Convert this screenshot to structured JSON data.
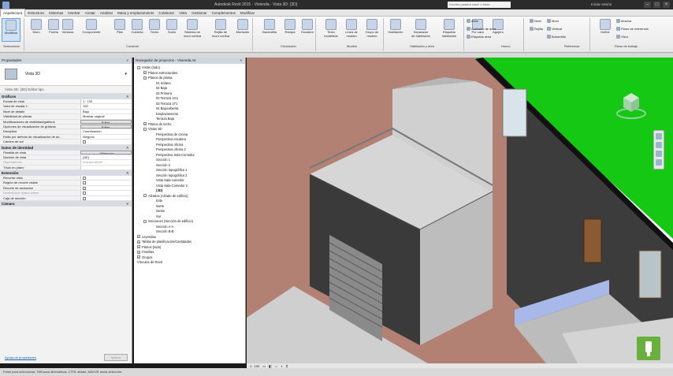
{
  "titlebar": {
    "title": "Autodesk Revit 2015 - Vivienda - Vista 3D: {3D}",
    "search_placeholder": "Escriba palabra clave o frase",
    "user": "Iniciar sesión"
  },
  "ribbon_tabs": [
    "Arquitectura",
    "Estructura",
    "Sistemas",
    "Insertar",
    "Anotar",
    "Analizar",
    "Masa y emplazamiento",
    "Colaborar",
    "Vista",
    "Gestionar",
    "Complementos",
    "Modificar"
  ],
  "ribbon": {
    "buttons": [
      {
        "label": "Modificar"
      },
      {
        "label": "Muro"
      },
      {
        "label": "Puerta"
      },
      {
        "label": "Ventana"
      },
      {
        "label": "Componente"
      },
      {
        "label": "Pilar"
      },
      {
        "label": "Cubierta"
      },
      {
        "label": "Techo"
      },
      {
        "label": "Suelo"
      },
      {
        "label": "Sistema de muro cortina"
      },
      {
        "label": "Rejilla de muro cortina"
      },
      {
        "label": "Montante"
      },
      {
        "label": "Barandilla"
      },
      {
        "label": "Rampa"
      },
      {
        "label": "Escalera"
      },
      {
        "label": "Texto modelado"
      },
      {
        "label": "Línea de modelo"
      },
      {
        "label": "Grupo de modelo"
      },
      {
        "label": "Habitación"
      },
      {
        "label": "Separador de habitación"
      },
      {
        "label": "Etiquetar habitación"
      },
      {
        "label": "Por cara"
      },
      {
        "label": "Agujero"
      },
      {
        "label": "Nivel"
      },
      {
        "label": "Rejilla"
      },
      {
        "label": "Definir"
      }
    ],
    "small": {
      "area": "Área",
      "contorno": "Contorno de área",
      "etiquetar_area": "Etiquetar área",
      "muro": "Muro",
      "vertical": "Vertical",
      "buhardilla": "Buhardilla",
      "mostrar": "Mostrar",
      "plano_ref": "Plano de referencia",
      "visor": "Visor"
    },
    "panels": [
      "Seleccionar",
      "Construir",
      "Circulación",
      "Modelo",
      "Habitación y área",
      "Hueco",
      "Referencia",
      "Plano de trabajo"
    ]
  },
  "properties": {
    "header": "Propiedades",
    "type": "Vista 3D",
    "edit_type": "Vista 3D: {3D}    Editar tipo",
    "sections": {
      "graphics": "Gráficos",
      "identity": "Datos de identidad",
      "extents": "Extensión",
      "camera": "Cámara"
    },
    "graphics_rows": [
      {
        "k": "Escala de vista",
        "v": "1 : 100"
      },
      {
        "k": "Valor de escala    1:",
        "v": "100"
      },
      {
        "k": "Nivel de detalle",
        "v": "Bajo"
      },
      {
        "k": "Visibilidad de piezas",
        "v": "Mostrar original"
      },
      {
        "k": "Modificaciones de visibilidad/gráficos",
        "v": "Editar..."
      },
      {
        "k": "Opciones de visualización de gráficos",
        "v": "Editar..."
      },
      {
        "k": "Disciplina",
        "v": "Coordinación"
      },
      {
        "k": "Estilo por defecto de visualización de an...",
        "v": "Ninguno"
      },
      {
        "k": "Camino de sol",
        "v": ""
      }
    ],
    "identity_rows": [
      {
        "k": "Plantilla de vista",
        "v": "<Ninguno>"
      },
      {
        "k": "Nombre de vista",
        "v": "{3D}"
      },
      {
        "k": "Dependencia",
        "v": "Independiente"
      },
      {
        "k": "Título en plano",
        "v": ""
      }
    ],
    "extent_rows": [
      {
        "k": "Recortar vista",
        "v": ""
      },
      {
        "k": "Región de recorte visible",
        "v": ""
      },
      {
        "k": "Recorte de anotación",
        "v": ""
      },
      {
        "k": "Delimitación lejana activa",
        "v": ""
      },
      {
        "k": "Caja de sección",
        "v": ""
      }
    ],
    "help_link": "Ayuda de propiedades",
    "apply": "Aplicar"
  },
  "browser": {
    "header": "Navegador de proyectos - Vivienda.rvt",
    "items": [
      {
        "t": "Vistas (todo)",
        "lvl": 0,
        "pm": "-"
      },
      {
        "t": "Planos estructurales",
        "lvl": 1,
        "pm": "+"
      },
      {
        "t": "Planos de planta",
        "lvl": 1,
        "pm": "-"
      },
      {
        "t": "01 Sótano",
        "lvl": 3
      },
      {
        "t": "02 Baja",
        "lvl": 3
      },
      {
        "t": "03 Primera",
        "lvl": 3
      },
      {
        "t": "03 Terraza 1G1",
        "lvl": 3
      },
      {
        "t": "03 Terraza 1T1",
        "lvl": 3
      },
      {
        "t": "04 Bajocubierta",
        "lvl": 3
      },
      {
        "t": "Emplazamiento",
        "lvl": 3
      },
      {
        "t": "Terraza Baja",
        "lvl": 3
      },
      {
        "t": "Planos de techo",
        "lvl": 1,
        "pm": "+"
      },
      {
        "t": "Vistas 3D",
        "lvl": 1,
        "pm": "-"
      },
      {
        "t": "Perspectiva de cocina",
        "lvl": 3
      },
      {
        "t": "Perspectiva escalera",
        "lvl": 3
      },
      {
        "t": "Perspectiva oficina",
        "lvl": 3
      },
      {
        "t": "Perspectiva oficina 2",
        "lvl": 3
      },
      {
        "t": "Perspectiva Sala-Comedor",
        "lvl": 3
      },
      {
        "t": "Sección 1",
        "lvl": 3
      },
      {
        "t": "Sección 2",
        "lvl": 3
      },
      {
        "t": "Sección topográfica 1",
        "lvl": 3
      },
      {
        "t": "Sección topográfica 2",
        "lvl": 3
      },
      {
        "t": "Vista Sala-comedor",
        "lvl": 3
      },
      {
        "t": "Vista Sala-Comedor 2",
        "lvl": 3
      },
      {
        "t": "{3D}",
        "lvl": 3,
        "bold": true
      },
      {
        "t": "Alzados (Alzado de edificio)",
        "lvl": 1,
        "pm": "-"
      },
      {
        "t": "Este",
        "lvl": 3
      },
      {
        "t": "Norte",
        "lvl": 3
      },
      {
        "t": "Oeste",
        "lvl": 3
      },
      {
        "t": "Sur",
        "lvl": 3
      },
      {
        "t": "Secciones (Sección de edificio)",
        "lvl": 1,
        "pm": "-"
      },
      {
        "t": "Sección A-A",
        "lvl": 3
      },
      {
        "t": "Sección B-B",
        "lvl": 3
      },
      {
        "t": "Leyendas",
        "lvl": 0,
        "pm": "+"
      },
      {
        "t": "Tablas de planificación/Cantidades",
        "lvl": 0,
        "pm": "+"
      },
      {
        "t": "Planos (todo)",
        "lvl": 0,
        "pm": "+"
      },
      {
        "t": "Familias",
        "lvl": 0,
        "pm": "+"
      },
      {
        "t": "Grupos",
        "lvl": 0,
        "pm": "+"
      },
      {
        "t": "Vínculos de Revit",
        "lvl": 0
      }
    ]
  },
  "viewcontrol": {
    "scale": "1 : 100"
  },
  "status": {
    "text": "Pulse para seleccionar, TAB para alternativas, CTRL añade, MAYÚS anula selección."
  },
  "colors": {
    "grass": "#14c814",
    "floor": "#b38174",
    "wall_dark": "#3d3d3d",
    "wall_light": "#d9d9d9",
    "accent": "#2b73c7"
  }
}
